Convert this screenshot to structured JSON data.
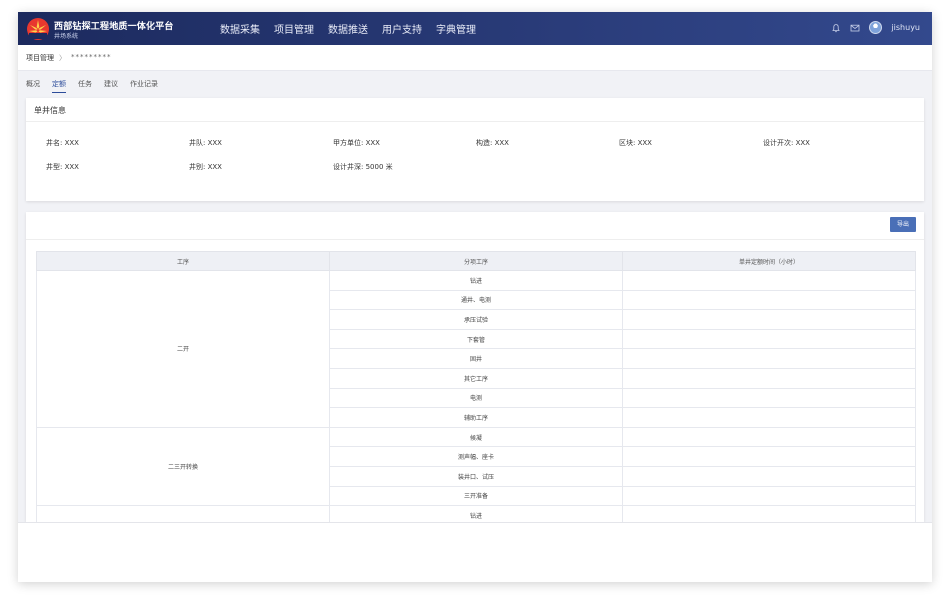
{
  "brand": {
    "title": "西部钻探工程地质一体化平台",
    "subtitle": "井场系统"
  },
  "nav": [
    "数据采集",
    "项目管理",
    "数据推送",
    "用户支持",
    "字典管理"
  ],
  "user": {
    "name": "jishuyu"
  },
  "breadcrumb": {
    "root": "项目管理",
    "separator": "〉",
    "current": "*********"
  },
  "subtabs": [
    {
      "label": "概况",
      "active": false
    },
    {
      "label": "定额",
      "active": true
    },
    {
      "label": "任务",
      "active": false
    },
    {
      "label": "建议",
      "active": false
    },
    {
      "label": "作业记录",
      "active": false
    }
  ],
  "well_info": {
    "title": "单井信息",
    "fields": [
      [
        "井名: XXX",
        "井队: XXX",
        "甲方单位: XXX",
        "构造: XXX",
        "区块: XXX",
        "设计开次: XXX"
      ],
      [
        "井型: XXX",
        "井别: XXX",
        "设计井深: 5000 米"
      ]
    ]
  },
  "quota_table": {
    "export_label": "导出",
    "headers": [
      "工序",
      "分项工序",
      "单井定额时间（小时）"
    ],
    "groups": [
      {
        "process": "二开",
        "rows": [
          "钻进",
          "通井、电测",
          "承压试验",
          "下套管",
          "固井",
          "其它工序",
          "电测",
          "辅助工序"
        ]
      },
      {
        "process": "二三开转换",
        "rows": [
          "候凝",
          "测声幅、座卡",
          "装井口、试压",
          "三开准备"
        ]
      },
      {
        "process": "",
        "rows": [
          "钻进"
        ]
      }
    ]
  }
}
